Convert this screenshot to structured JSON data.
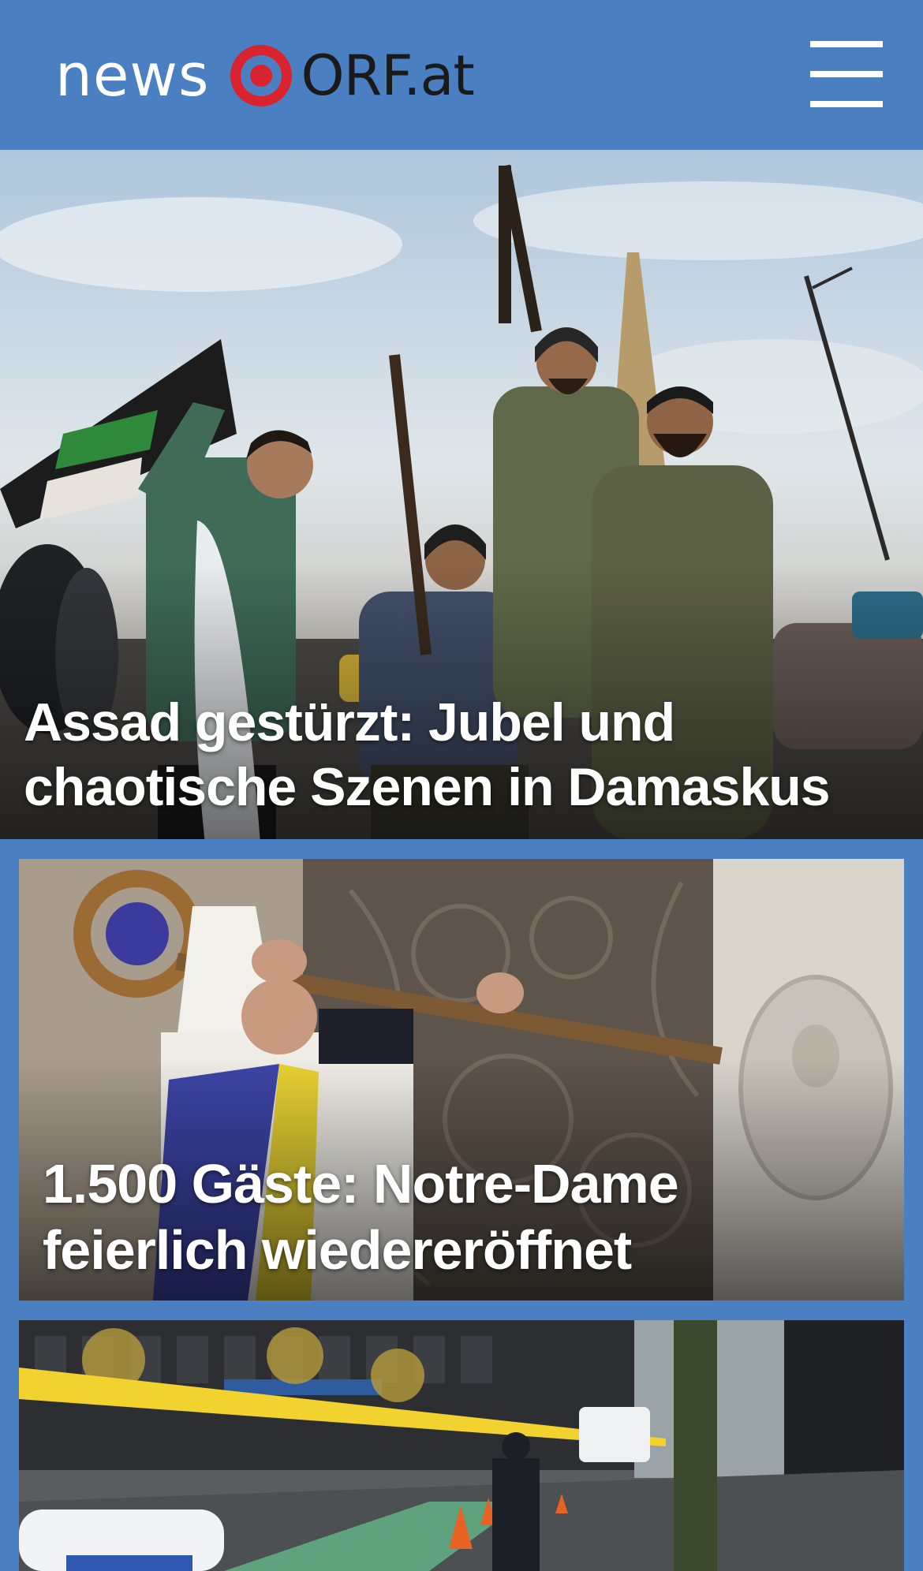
{
  "header": {
    "logo_news": "news",
    "logo_orf": "ORF.at",
    "accent_color": "#4a7fc1",
    "brand_red": "#d9232e",
    "menu_icon": "hamburger-menu-icon"
  },
  "articles": [
    {
      "title": "Assad gestürzt: Jubel und chaotische Szenen in Damaskus",
      "image": "photo-fighters-celebrating"
    },
    {
      "title": "1.500 Gäste: Notre-Dame feierlich wiedereröffnet",
      "image": "photo-archbishop-crosier"
    },
    {
      "title": "",
      "image": "photo-police-tape-street"
    }
  ]
}
